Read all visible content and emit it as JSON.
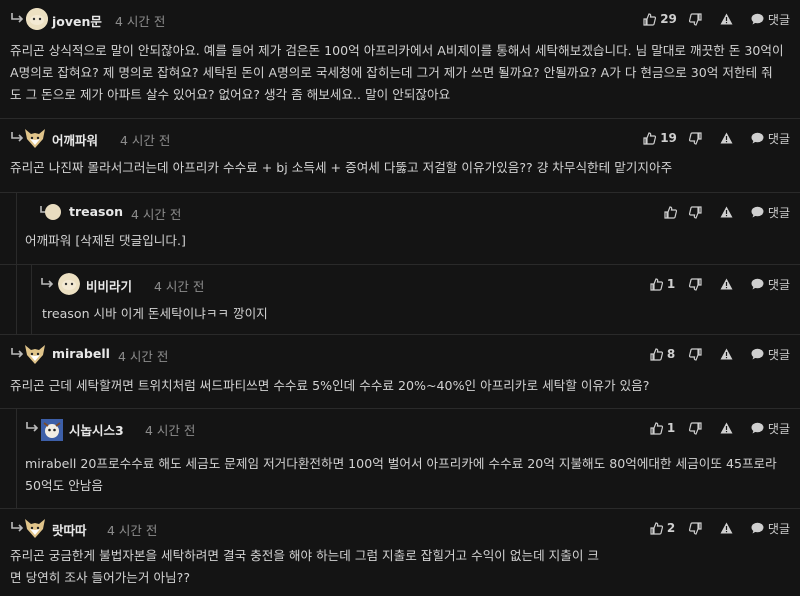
{
  "labels": {
    "reply": "댓글"
  },
  "comments": [
    {
      "name": "joven문",
      "time": "4 시간 전",
      "likes": "29",
      "body": "쥬리곤 상식적으로 말이 안되잖아요. 예를 들어 제가 검은돈 100억 아프리카에서 A비제이를 통해서 세탁해보겠습니다. 님 말대로 깨끗한 돈 30억이 A명의로 잡혀요? 제 명의로 잡혀요? 세탁된 돈이 A명의로 국세청에 잡히는데 그거 제가 쓰면 될까요? 안될까요? A가 다 현금으로 30억 저한테 줘도 그 돈으로 제가 아파트 살수 있어요? 없어요? 생각 좀 해보세요.. 말이 안되잖아요"
    },
    {
      "name": "어깨파워",
      "time": "4 시간 전",
      "likes": "19",
      "body": "쥬리곤 나진짜 몰라서그러는데 아프리카 수수료 + bj 소득세 + 증여세 다뚫고 저걸할 이유가있음?? 걍 차무식한테 맡기지아주"
    },
    {
      "name": "treason",
      "time": "4 시간 전",
      "likes": "",
      "body": "어깨파워 [삭제된 댓글입니다.]"
    },
    {
      "name": "비비라기",
      "time": "4 시간 전",
      "likes": "1",
      "body": "treason 시바 이게 돈세탁이냐ㅋㅋ 깡이지"
    },
    {
      "name": "mirabell",
      "time": "4 시간 전",
      "likes": "8",
      "body": "쥬리곤 근데 세탁할꺼면 트위치처럼 써드파티쓰면 수수료 5%인데 수수료 20%~40%인 아프리카로 세탁할 이유가 있음?"
    },
    {
      "name": "시놉시스3",
      "time": "4 시간 전",
      "likes": "1",
      "body": "mirabell 20프로수수료 해도 세금도 문제임 저거다환전하면 100억 벌어서 아프리카에 수수료 20억 지불해도 80억에대한 세금이또 45프로라 50억도 안남음"
    },
    {
      "name": "랏따따",
      "time": "4 시간 전",
      "likes": "2",
      "body": "쥬리곤 궁금한게 불법자본을 세탁하려면 결국 충전을 해야 하는데 그럼 지출로 잡힐거고 수익이 없는데 지출이 크면 당연히 조사 들어가는거 아님??"
    }
  ]
}
